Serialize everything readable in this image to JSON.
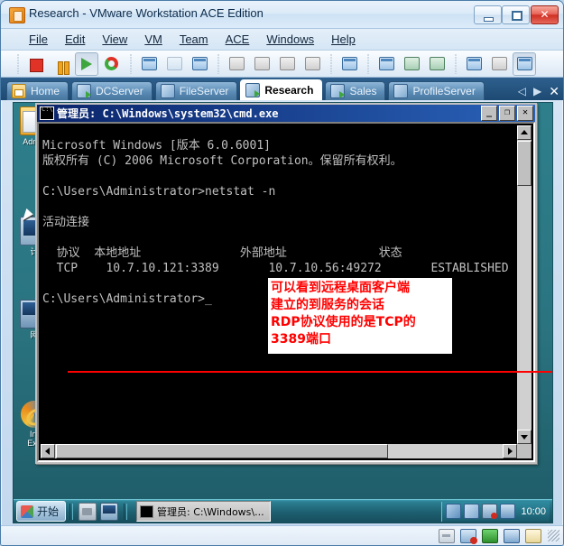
{
  "window": {
    "title": "Research - VMware Workstation ACE Edition",
    "app_icon": "vmware-icon",
    "buttons": {
      "minimize": "minimize-button",
      "maximize": "maximize-button",
      "close": "✕"
    }
  },
  "menubar": {
    "items": [
      {
        "label": "File",
        "accel": "F"
      },
      {
        "label": "Edit",
        "accel": "E"
      },
      {
        "label": "View",
        "accel": "V"
      },
      {
        "label": "VM",
        "accel": "M"
      },
      {
        "label": "Team",
        "accel": "T"
      },
      {
        "label": "ACE",
        "accel": "C"
      },
      {
        "label": "Windows",
        "accel": "W"
      },
      {
        "label": "Help",
        "accel": "H"
      }
    ]
  },
  "toolbar": {
    "buttons": [
      {
        "name": "power-off-button",
        "icon": "stop-icon"
      },
      {
        "name": "suspend-button",
        "icon": "pause-icon"
      },
      {
        "name": "power-on-button",
        "icon": "play-icon"
      },
      {
        "name": "reset-button",
        "icon": "reset-icon"
      },
      {
        "name": "new-snapshot-button",
        "icon": "snapshot-new-icon"
      },
      {
        "name": "revert-snapshot-button",
        "icon": "snapshot-revert-icon"
      },
      {
        "name": "snapshot-manager-button",
        "icon": "snapshot-manager-icon"
      },
      {
        "name": "clone-button",
        "icon": "clone-icon"
      },
      {
        "name": "clone-team-button",
        "icon": "clone-team-icon"
      },
      {
        "name": "new-vm-button",
        "icon": "new-vm-icon"
      },
      {
        "name": "usb-button",
        "icon": "usb-icon"
      },
      {
        "name": "capture-button",
        "icon": "capture-icon"
      },
      {
        "name": "show-sidebar-button",
        "icon": "sidebar-icon"
      },
      {
        "name": "quick-switch-button",
        "icon": "quick-switch-icon"
      },
      {
        "name": "fullscreen-button",
        "icon": "fullscreen-icon"
      },
      {
        "name": "settings-button",
        "icon": "wrench-icon"
      },
      {
        "name": "summary-button",
        "icon": "summary-icon"
      },
      {
        "name": "console-view-button",
        "icon": "console-view-icon"
      }
    ]
  },
  "tabs": {
    "items": [
      {
        "label": "Home",
        "icon": "home-icon",
        "active": false,
        "running": false
      },
      {
        "label": "DCServer",
        "icon": "vm-icon",
        "active": false,
        "running": true
      },
      {
        "label": "FileServer",
        "icon": "vm-icon",
        "active": false,
        "running": false
      },
      {
        "label": "Research",
        "icon": "vm-icon",
        "active": true,
        "running": true
      },
      {
        "label": "Sales",
        "icon": "vm-icon",
        "active": false,
        "running": true
      },
      {
        "label": "ProfileServer",
        "icon": "vm-icon",
        "active": false,
        "running": false
      }
    ],
    "nav": {
      "prev": "◁",
      "next": "▶",
      "close": "✕"
    }
  },
  "vm_desktop": {
    "icons": [
      {
        "label": "Admin",
        "icon": "folder-icon"
      },
      {
        "label": "计",
        "icon": "computer-icon"
      },
      {
        "label": "网",
        "icon": "network-icon"
      },
      {
        "label": "Int\nExp",
        "icon": "internet-explorer-icon"
      }
    ]
  },
  "cmd_window": {
    "title": "管理员: C:\\Windows\\system32\\cmd.exe",
    "icon": "cmd-icon",
    "buttons": {
      "minimize": "_",
      "maximize": "❐",
      "close": "✕"
    },
    "console_text": "Microsoft Windows [版本 6.0.6001]\n版权所有 (C) 2006 Microsoft Corporation。保留所有权利。\n\nC:\\Users\\Administrator>netstat -n\n\n活动连接\n\n  协议  本地地址              外部地址             状态\n  TCP    10.7.10.121:3389       10.7.10.56:49272       ESTABLISHED\n\nC:\\Users\\Administrator>_",
    "netstat": {
      "heading": "活动连接",
      "columns": [
        "协议",
        "本地地址",
        "外部地址",
        "状态"
      ],
      "rows": [
        {
          "protocol": "TCP",
          "local": "10.7.10.121:3389",
          "foreign": "10.7.10.56:49272",
          "state": "ESTABLISHED"
        }
      ]
    },
    "prompt_before": "C:\\Users\\Administrator>",
    "command": "netstat -n",
    "prompt_after": "C:\\Users\\Administrator>",
    "version_line": "Microsoft Windows [版本 6.0.6001]",
    "copyright_line": "版权所有 (C) 2006 Microsoft Corporation。保留所有权利。"
  },
  "annotation": {
    "color": "#ff0000",
    "background": "#ffffff",
    "lines": [
      "可以看到远程桌面客户端",
      "建立的到服务的会话",
      "RDP协议使用的是TCP的",
      "3389端口"
    ]
  },
  "vm_taskbar": {
    "start_label": "开始",
    "quick_launch": [
      "show-desktop-icon",
      "switch-window-icon"
    ],
    "task_buttons": [
      {
        "label": "管理员: C:\\Windows\\...",
        "icon": "cmd-icon"
      }
    ],
    "tray_icons": [
      "network-status-icon",
      "two-windows-icon",
      "vmware-tools-icon",
      "volume-icon"
    ],
    "clock": "10:00"
  },
  "statusbar": {
    "icons": [
      "floppy-icon",
      "network-adapter-icon",
      "cdrom-icon",
      "sound-icon",
      "printer-icon"
    ],
    "resize_grip": "resize-grip"
  }
}
